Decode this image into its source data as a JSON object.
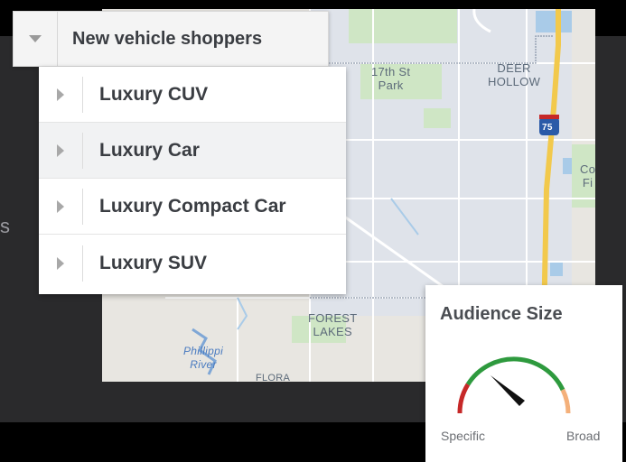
{
  "left_stub_text": "s",
  "dropdown": {
    "title": "New vehicle shoppers",
    "items": [
      {
        "label": "Luxury CUV"
      },
      {
        "label": "Luxury Car"
      },
      {
        "label": "Luxury Compact Car"
      },
      {
        "label": "Luxury SUV"
      }
    ]
  },
  "map": {
    "labels": {
      "park": "17th St\nPark",
      "deer_hollow": "DEER\nHOLLOW",
      "highway": "75",
      "forest_lakes": "FOREST\nLAKES",
      "river": "Phillippi\nRiver",
      "flora": "FLORA",
      "right_cut": "Co\nFi"
    }
  },
  "audience": {
    "heading": "Audience Size",
    "left_label": "Specific",
    "right_label": "Broad"
  },
  "colors": {
    "pin": "#1f4e8c",
    "gauge_red": "#c62828",
    "gauge_green": "#2e9a3e",
    "gauge_orange": "#f4b07a",
    "needle": "#111111"
  }
}
